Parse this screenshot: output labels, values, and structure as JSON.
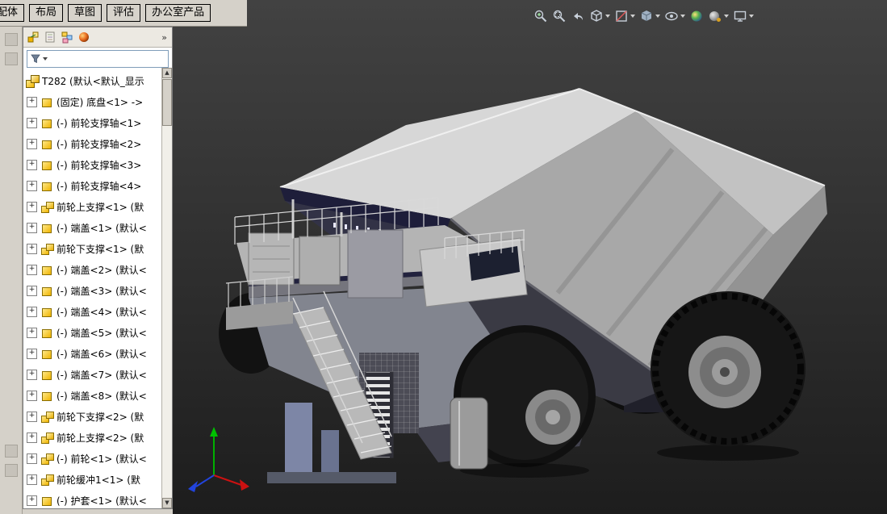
{
  "toolbar": {
    "tabs": [
      {
        "id": "assembly",
        "label": "配体"
      },
      {
        "id": "layout",
        "label": "布局"
      },
      {
        "id": "sketch",
        "label": "草图"
      },
      {
        "id": "evaluate",
        "label": "评估"
      },
      {
        "id": "office",
        "label": "办公室产品"
      }
    ]
  },
  "heads_up": {
    "icons": [
      {
        "name": "zoom-to-fit",
        "dropdown": false
      },
      {
        "name": "zoom-to-area",
        "dropdown": false
      },
      {
        "name": "previous-view",
        "dropdown": false
      },
      {
        "name": "view-orientation",
        "dropdown": true
      },
      {
        "name": "section-view",
        "dropdown": true
      },
      {
        "name": "display-style",
        "dropdown": true
      },
      {
        "name": "hide-show-items",
        "dropdown": true
      },
      {
        "name": "edit-appearance",
        "dropdown": false
      },
      {
        "name": "apply-scene",
        "dropdown": true
      },
      {
        "name": "view-settings",
        "dropdown": true
      }
    ]
  },
  "panel": {
    "header_tabs": [
      {
        "name": "featuremanager-design-tree"
      },
      {
        "name": "propertymanager"
      },
      {
        "name": "configurationmanager"
      },
      {
        "name": "appearances"
      }
    ],
    "overflow": "»"
  },
  "feature_tree": {
    "root_label": "T282 (默认<默认_显示",
    "items": [
      {
        "label": "(固定) 底盘<1> ->",
        "icon": "part"
      },
      {
        "label": "(-) 前轮支撑轴<1>",
        "icon": "part"
      },
      {
        "label": "(-) 前轮支撑轴<2>",
        "icon": "part"
      },
      {
        "label": "(-) 前轮支撑轴<3>",
        "icon": "part"
      },
      {
        "label": "(-) 前轮支撑轴<4>",
        "icon": "part"
      },
      {
        "label": "前轮上支撑<1> (默",
        "icon": "asm"
      },
      {
        "label": "(-) 端盖<1> (默认<",
        "icon": "part"
      },
      {
        "label": "前轮下支撑<1> (默",
        "icon": "asm"
      },
      {
        "label": "(-) 端盖<2> (默认<",
        "icon": "part"
      },
      {
        "label": "(-) 端盖<3> (默认<",
        "icon": "part"
      },
      {
        "label": "(-) 端盖<4> (默认<",
        "icon": "part"
      },
      {
        "label": "(-) 端盖<5> (默认<",
        "icon": "part"
      },
      {
        "label": "(-) 端盖<6> (默认<",
        "icon": "part"
      },
      {
        "label": "(-) 端盖<7> (默认<",
        "icon": "part"
      },
      {
        "label": "(-) 端盖<8> (默认<",
        "icon": "part"
      },
      {
        "label": "前轮下支撑<2> (默",
        "icon": "asm"
      },
      {
        "label": "前轮上支撑<2> (默",
        "icon": "asm"
      },
      {
        "label": "(-) 前轮<1> (默认<",
        "icon": "asm"
      },
      {
        "label": "前轮缓冲1<1> (默",
        "icon": "asm"
      },
      {
        "label": "(-) 护套<1> (默认<",
        "icon": "part"
      }
    ]
  },
  "viewport": {
    "model": "T282 mining dump truck",
    "triad_axes": {
      "up": "green",
      "right": "red",
      "left": "blue"
    }
  },
  "colors": {
    "toolbar_bg": "#d5d1c9",
    "viewport_bg": "#2b2b2b",
    "tree_icon_yellow": "#f0b400",
    "truck_body": "#c8c8c8",
    "truck_navy": "#1e1e3a"
  }
}
